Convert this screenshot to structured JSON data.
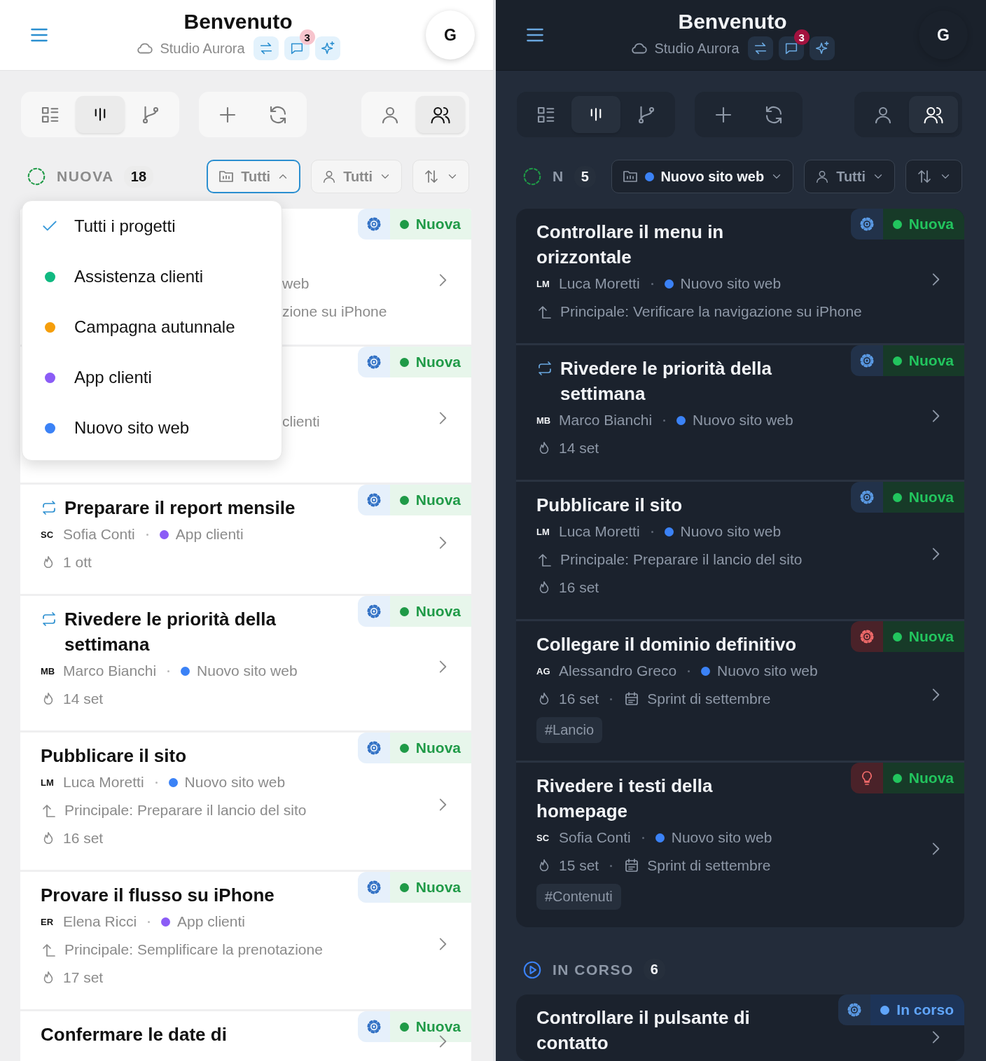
{
  "panels": [
    {
      "kind": "light",
      "header": {
        "title": "Benvenuto",
        "workspace": "Studio Aurora",
        "badge": "3",
        "avatar": "G"
      },
      "toolbar": {
        "views": [
          {
            "kind": "list",
            "selected": false
          },
          {
            "kind": "board",
            "selected": true
          },
          {
            "kind": "branch",
            "selected": false
          }
        ],
        "scopes": [
          {
            "kind": "person",
            "selected": false
          },
          {
            "kind": "people",
            "selected": true
          }
        ]
      },
      "column": {
        "label": "NUOVA",
        "count": "18",
        "kind": "new"
      },
      "filters": {
        "project": {
          "label": "Tutti",
          "expanded": true
        },
        "assignee": {
          "label": "Tutti"
        }
      },
      "dropdown": [
        {
          "label": "Tutti i progetti",
          "selected": true
        },
        {
          "label": "Assistenza clienti",
          "color": "#10b981",
          "selected": false
        },
        {
          "label": "Campagna autunnale",
          "color": "#f59e0b",
          "selected": false
        },
        {
          "label": "App clienti",
          "color": "#8b5cf6",
          "selected": false
        },
        {
          "label": "Nuovo sito web",
          "color": "#3b82f6",
          "selected": false
        }
      ],
      "cards": [
        {
          "kind": "covered",
          "fragments": [
            "web",
            "zione su iPhone"
          ],
          "type_tag": {
            "kind": "gear",
            "flagged": false
          },
          "status": {
            "label": "Nuova",
            "kind": "new"
          }
        },
        {
          "kind": "covered",
          "fragments": [
            "clienti"
          ],
          "type_tag": {
            "kind": "gear",
            "flagged": false
          },
          "status": {
            "label": "Nuova",
            "kind": "new"
          }
        },
        {
          "kind": "task",
          "title": "Preparare il report mensile",
          "recurring": true,
          "initials": "SC",
          "assignee": "Sofia Conti",
          "project": {
            "name": "App clienti",
            "color": "#8b5cf6"
          },
          "due": "1 ott",
          "type_tag": {
            "kind": "gear",
            "flagged": false
          },
          "status": {
            "label": "Nuova",
            "kind": "new"
          }
        },
        {
          "kind": "task",
          "title": "Rivedere le priorità della settimana",
          "recurring": true,
          "initials": "MB",
          "assignee": "Marco Bianchi",
          "project": {
            "name": "Nuovo sito web",
            "color": "#3b82f6"
          },
          "due": "14 set",
          "type_tag": {
            "kind": "gear",
            "flagged": false
          },
          "status": {
            "label": "Nuova",
            "kind": "new"
          }
        },
        {
          "kind": "task",
          "title": "Pubblicare il sito",
          "recurring": false,
          "initials": "LM",
          "assignee": "Luca Moretti",
          "project": {
            "name": "Nuovo sito web",
            "color": "#3b82f6"
          },
          "parent": "Principale: Preparare il lancio del sito",
          "due": "16 set",
          "type_tag": {
            "kind": "gear",
            "flagged": false
          },
          "status": {
            "label": "Nuova",
            "kind": "new"
          }
        },
        {
          "kind": "task",
          "title": "Provare il flusso su iPhone",
          "recurring": false,
          "initials": "ER",
          "assignee": "Elena Ricci",
          "project": {
            "name": "App clienti",
            "color": "#8b5cf6"
          },
          "parent": "Principale: Semplificare la prenotazione",
          "due": "17 set",
          "type_tag": {
            "kind": "gear",
            "flagged": false
          },
          "status": {
            "label": "Nuova",
            "kind": "new"
          }
        },
        {
          "kind": "task",
          "title": "Confermare le date di",
          "recurring": false,
          "type_tag": {
            "kind": "gear",
            "flagged": false
          },
          "status": {
            "label": "Nuova",
            "kind": "new"
          }
        }
      ]
    },
    {
      "kind": "dark",
      "header": {
        "title": "Benvenuto",
        "workspace": "Studio Aurora",
        "badge": "3",
        "avatar": "G"
      },
      "toolbar": {
        "views": [
          {
            "kind": "list",
            "selected": false
          },
          {
            "kind": "board",
            "selected": true
          },
          {
            "kind": "branch",
            "selected": false
          }
        ],
        "scopes": [
          {
            "kind": "person",
            "selected": false
          },
          {
            "kind": "people",
            "selected": true
          }
        ]
      },
      "column": {
        "label": "N",
        "count": "5",
        "kind": "new"
      },
      "filters": {
        "project": {
          "label": "Nuovo sito web",
          "color": "#3b82f6",
          "expanded": false
        },
        "assignee": {
          "label": "Tutti"
        }
      },
      "cards": [
        {
          "kind": "task",
          "title": "Controllare il menu in orizzontale",
          "recurring": false,
          "initials": "LM",
          "assignee": "Luca Moretti",
          "project": {
            "name": "Nuovo sito web",
            "color": "#3b82f6"
          },
          "parent": "Principale: Verificare la navigazione su iPhone",
          "type_tag": {
            "kind": "gear",
            "flagged": false
          },
          "status": {
            "label": "Nuova",
            "kind": "new"
          }
        },
        {
          "kind": "task",
          "title": "Rivedere le priorità della settimana",
          "recurring": true,
          "initials": "MB",
          "assignee": "Marco Bianchi",
          "project": {
            "name": "Nuovo sito web",
            "color": "#3b82f6"
          },
          "due": "14 set",
          "type_tag": {
            "kind": "gear",
            "flagged": false
          },
          "status": {
            "label": "Nuova",
            "kind": "new"
          }
        },
        {
          "kind": "task",
          "title": "Pubblicare il sito",
          "recurring": false,
          "initials": "LM",
          "assignee": "Luca Moretti",
          "project": {
            "name": "Nuovo sito web",
            "color": "#3b82f6"
          },
          "parent": "Principale: Preparare il lancio del sito",
          "due": "16 set",
          "type_tag": {
            "kind": "gear",
            "flagged": false
          },
          "status": {
            "label": "Nuova",
            "kind": "new"
          }
        },
        {
          "kind": "task",
          "title": "Collegare il dominio definitivo",
          "recurring": false,
          "initials": "AG",
          "assignee": "Alessandro Greco",
          "project": {
            "name": "Nuovo sito web",
            "color": "#3b82f6"
          },
          "due": "16 set",
          "sprint": "Sprint di settembre",
          "tag": "#Lancio",
          "type_tag": {
            "kind": "gear",
            "flagged": true
          },
          "status": {
            "label": "Nuova",
            "kind": "new"
          }
        },
        {
          "kind": "task",
          "title": "Rivedere i testi della homepage",
          "recurring": false,
          "initials": "SC",
          "assignee": "Sofia Conti",
          "project": {
            "name": "Nuovo sito web",
            "color": "#3b82f6"
          },
          "due": "15 set",
          "sprint": "Sprint di settembre",
          "tag": "#Contenuti",
          "type_tag": {
            "kind": "bulb",
            "flagged": true
          },
          "status": {
            "label": "Nuova",
            "kind": "new"
          }
        }
      ],
      "next_column": {
        "label": "IN CORSO",
        "count": "6",
        "kind": "in-progress",
        "cards": [
          {
            "kind": "task",
            "title": "Controllare il pulsante di contatto",
            "recurring": false,
            "type_tag": {
              "kind": "gear",
              "flagged": false
            },
            "status": {
              "label": "In corso",
              "kind": "in-progress"
            }
          }
        ]
      }
    }
  ]
}
